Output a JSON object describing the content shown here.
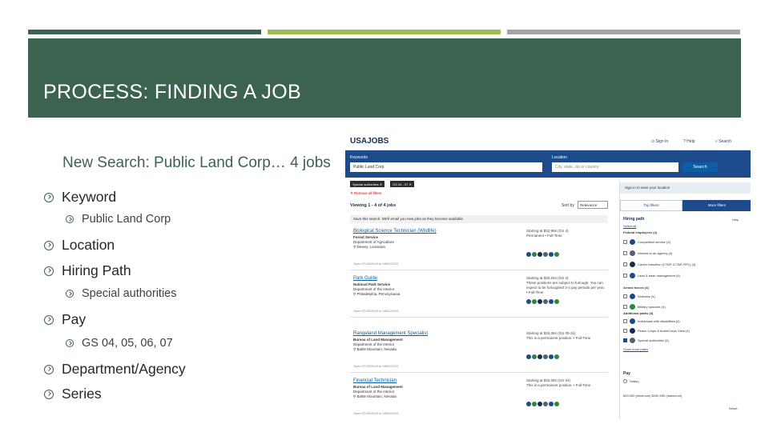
{
  "slide": {
    "title": "PROCESS: FINDING A JOB",
    "subtitle": "New Search: Public Land Corp… 4 jobs"
  },
  "bullets": [
    {
      "level": 1,
      "text": "Keyword"
    },
    {
      "level": 2,
      "text": "Public Land Corp"
    },
    {
      "level": 1,
      "text": "Location"
    },
    {
      "level": 1,
      "text": "Hiring Path"
    },
    {
      "level": 2,
      "text": "Special authorities"
    },
    {
      "level": 1,
      "text": "Pay"
    },
    {
      "level": 2,
      "text": "GS 04, 05, 06, 07"
    },
    {
      "level": 1,
      "text": "Department/Agency"
    },
    {
      "level": 1,
      "text": "Series"
    }
  ],
  "colors": {
    "accent": "#3c6250",
    "accent2": "#9bbb59",
    "gray": "#a5a5a5",
    "usajobs_blue": "#1d4a8a"
  },
  "usajobs": {
    "logo": "USAJOBS",
    "nav": {
      "signin": "Sign In",
      "help": "Help",
      "search": "Search"
    },
    "keywords_label": "Keywords",
    "keywords_value": "Public Land Corp",
    "location_label": "Location",
    "location_placeholder": "City, state, zip or country",
    "search_button": "Search",
    "chips": [
      "Special authorities ✕",
      "GS 04 - 07 ✕"
    ],
    "remove_all": "✕ Remove all filters",
    "viewing": "Viewing 1 - 4 of 4 jobs",
    "sort_label": "Sort by",
    "sort_value": "Relevance",
    "save_bar": "Save this search. We'll email you new jobs as they become available.",
    "jobs": [
      {
        "title": "Biological Science Technician (Wildlife)",
        "agency": "Forest Service",
        "dept": "Department of Agriculture",
        "location": "Dewey, Louisiana",
        "pay": "Starting at $32,956 (GS 4)",
        "type": "Permanent • Full-Time",
        "open": "Open 07/26/2019 to 08/02/2019"
      },
      {
        "title": "Park Guide",
        "agency": "National Park Service",
        "dept": "Department of the Interior",
        "location": "Philadelphia, Pennsylvania",
        "pay": "Starting at $30,594 (GS 4)",
        "type": "These positions are subject to furlough. You can expect to be furloughed 3-4 pay periods per year. • Full-Time",
        "open": "Open 07/26/2019 to 08/01/2019"
      },
      {
        "title": "Rangeland Management Specialist",
        "agency": "Bureau of Land Management",
        "dept": "Department of the Interior",
        "location": "Battle Mountain, Nevada",
        "pay": "Starting at $33,394 (GS 05-11)",
        "type": "This is a permanent position. • Full-Time",
        "open": "Open 07/25/2019 to 08/02/2019"
      },
      {
        "title": "Financial Technician",
        "agency": "Bureau of Land Management",
        "dept": "Department of the Interior",
        "location": "Battle Mountain, Nevada",
        "pay": "Starting at $32,060 (GS 04)",
        "type": "This is a permanent position. • Full-Time",
        "open": "Open 07/26/2019 to 08/05/2019"
      }
    ],
    "sidebar": {
      "signin_bar": "Sign in to save your location",
      "tab_top": "Top filters",
      "tab_more": "More filters",
      "hiring_path": "Hiring path",
      "help": "Help",
      "select_all": "Select all",
      "federal_employees": "Federal employees (4)",
      "paths": [
        "Competitive service (4)",
        "Internal to an agency (4)",
        "Career transition (CTAP, ICTAP, RPL) (4)",
        "Land & base management (4)"
      ],
      "armed_forces": "Armed forces (4)",
      "armed": [
        "Veterans (4)",
        "Military spouses (4)"
      ],
      "additional": "Additional paths (4)",
      "more": [
        "Individuals with disabilities (4)",
        "Peace Corps & AmeriCorps Vista (4)",
        "Special authorities (4)"
      ],
      "more_link": "Show more paths",
      "pay": "Pay",
      "salary": "Salary",
      "salary_range": "$15,000 (minimum)   $150,000 (maximum)",
      "reset": "Reset"
    }
  }
}
